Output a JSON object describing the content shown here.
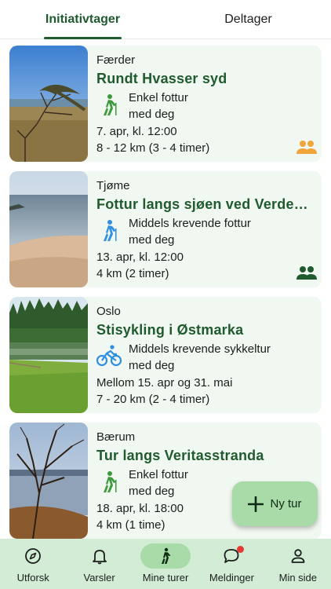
{
  "tabs": [
    {
      "label": "Initiativtager",
      "active": true
    },
    {
      "label": "Deltager",
      "active": false
    }
  ],
  "cards": [
    {
      "location": "Færder",
      "title": "Rundt Hvasser syd",
      "type_label": "Enkel fottur",
      "with_label": "med deg",
      "date": "7. apr, kl. 12:00",
      "distance": "8 - 12 km (3 - 4 timer)",
      "type_icon": "hiking-icon",
      "group_icon_color": "#f0a53a"
    },
    {
      "location": "Tjøme",
      "title": "Fottur langs sjøen ved Verdens ende",
      "type_label": "Middels krevende fottur",
      "with_label": "med deg",
      "date": "13. apr, kl. 12:00",
      "distance": "4 km (2 timer)",
      "type_icon": "hiking-icon",
      "group_icon_color": "#1f5b2e"
    },
    {
      "location": "Oslo",
      "title": "Stisykling i Østmarka",
      "type_label": "Middels krevende sykkeltur",
      "with_label": "med deg",
      "date": "Mellom 15. apr og 31. mai",
      "distance": "7 - 20 km (2 - 4 timer)",
      "type_icon": "bicycle-icon",
      "group_icon_color": null
    },
    {
      "location": "Bærum",
      "title": "Tur langs Veritasstranda",
      "type_label": "Enkel fottur",
      "with_label": "med deg",
      "date": "18. apr, kl. 18:00",
      "distance": "4 km (1 time)",
      "type_icon": "hiking-icon",
      "group_icon_color": null
    }
  ],
  "fab": {
    "label": "Ny tur"
  },
  "nav": [
    {
      "label": "Utforsk",
      "icon": "compass-icon",
      "active": false
    },
    {
      "label": "Varsler",
      "icon": "bell-icon",
      "active": false
    },
    {
      "label": "Mine turer",
      "icon": "walking-icon",
      "active": true
    },
    {
      "label": "Meldinger",
      "icon": "chat-icon",
      "active": false
    },
    {
      "label": "Min side",
      "icon": "person-icon",
      "active": false
    }
  ],
  "colors": {
    "accent": "#1f5b2e",
    "easy_icon": "#3c9a3c",
    "medium_icon": "#2f8fe0",
    "card_bg": "#f1f7f1",
    "nav_bg": "#d3ecd5",
    "fab_bg": "#a9dba9"
  }
}
